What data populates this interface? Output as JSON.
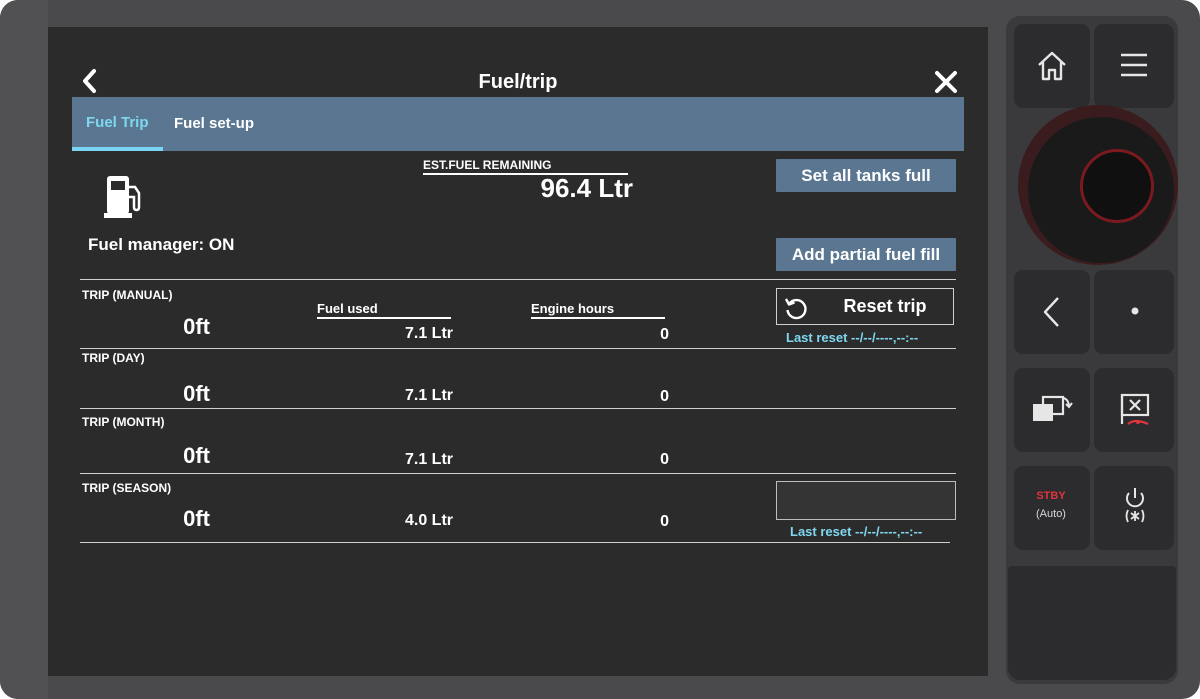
{
  "header": {
    "title": "Fuel/trip"
  },
  "tabs": [
    {
      "label": "Fuel Trip",
      "active": true
    },
    {
      "label": "Fuel set-up",
      "active": false
    }
  ],
  "summary": {
    "fuel_manager": "Fuel manager: ON",
    "est_label": "EST.FUEL REMAINING",
    "est_value": "96.4 Ltr"
  },
  "buttons": {
    "set_all_tanks_full": "Set all tanks full",
    "add_partial_fuel_fill": "Add partial fuel fill",
    "reset_trip": "Reset trip"
  },
  "columns": {
    "fuel_used": "Fuel used",
    "engine_hours": "Engine hours"
  },
  "trips": [
    {
      "label": "TRIP (MANUAL)",
      "distance": "0ft",
      "fuel": "7.1 Ltr",
      "hours": "0"
    },
    {
      "label": "TRIP (DAY)",
      "distance": "0ft",
      "fuel": "7.1 Ltr",
      "hours": "0"
    },
    {
      "label": "TRIP (MONTH)",
      "distance": "0ft",
      "fuel": "7.1 Ltr",
      "hours": "0"
    },
    {
      "label": "TRIP (SEASON)",
      "distance": "0ft",
      "fuel": "4.0 Ltr",
      "hours": "0"
    }
  ],
  "last_reset": [
    "Last reset --/--/----,--:--",
    "Last reset --/--/----,--:--"
  ],
  "hardware": {
    "stby": "STBY",
    "auto": "(Auto)"
  },
  "colors": {
    "accent": "#7fd7f0",
    "tabbar": "#5a7690",
    "screen": "#2b2b2b",
    "warning": "#e0343f"
  }
}
